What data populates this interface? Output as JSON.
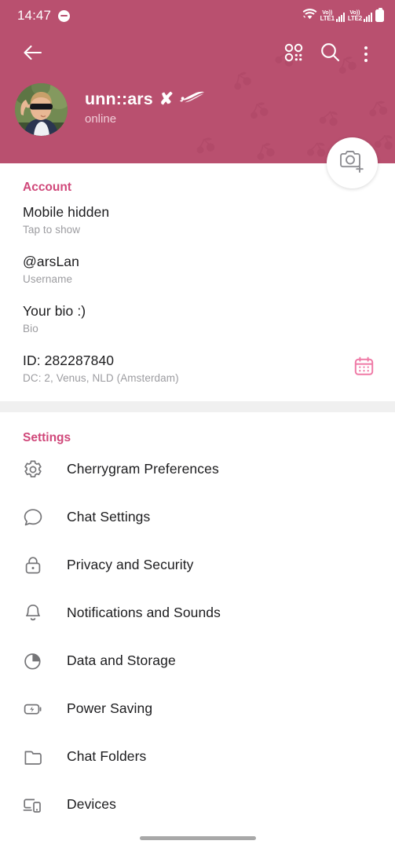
{
  "statusbar": {
    "time": "14:47",
    "dnd_icon": "do-not-disturb-icon",
    "wifi_icon": "wifi-icon",
    "sim1_vo": "Vo))",
    "sim1_lte": "LTE1",
    "sim2_vo": "Vo))",
    "sim2_lte": "LTE2",
    "battery_icon": "battery-icon"
  },
  "toolbar": {
    "back_icon": "back-arrow-icon",
    "qr_icon": "qr-code-icon",
    "search_icon": "search-icon",
    "menu_icon": "more-vertical-icon"
  },
  "profile": {
    "name": "unn::ars",
    "badge_x": "✘",
    "badge_rog": "rog-logo-icon",
    "status": "online",
    "avatar_name": "profile-avatar",
    "camera_fab_icon": "camera-add-icon"
  },
  "account": {
    "title": "Account",
    "rows": [
      {
        "main": "Mobile hidden",
        "sub": "Tap to show"
      },
      {
        "main": "@arsLan",
        "sub": "Username"
      },
      {
        "main": "Your bio :)",
        "sub": "Bio"
      },
      {
        "main": "ID: 282287840",
        "sub": "DC: 2, Venus, NLD (Amsterdam)",
        "trailing_icon": "calendar-icon"
      }
    ]
  },
  "settings": {
    "title": "Settings",
    "items": [
      {
        "label": "Cherrygram Preferences",
        "icon": "gear-icon"
      },
      {
        "label": "Chat Settings",
        "icon": "chat-bubble-icon"
      },
      {
        "label": "Privacy and Security",
        "icon": "lock-icon"
      },
      {
        "label": "Notifications and Sounds",
        "icon": "bell-icon"
      },
      {
        "label": "Data and Storage",
        "icon": "pie-chart-icon"
      },
      {
        "label": "Power Saving",
        "icon": "battery-bolt-icon"
      },
      {
        "label": "Chat Folders",
        "icon": "folder-icon"
      },
      {
        "label": "Devices",
        "icon": "devices-icon"
      }
    ]
  },
  "colors": {
    "header": "#b9506f",
    "accent": "#d0487a",
    "text": "#1c1c1e",
    "subtext": "#9c9ca0"
  }
}
